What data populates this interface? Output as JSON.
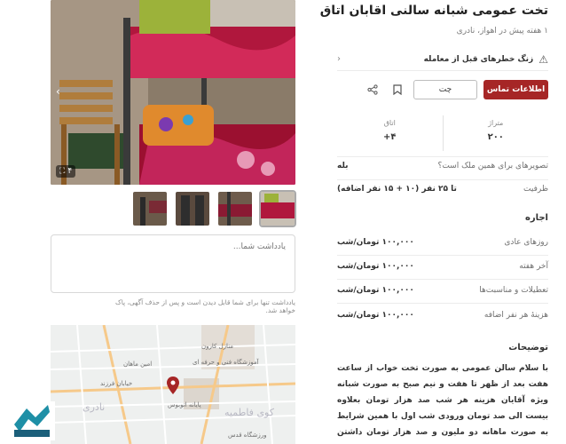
{
  "listing": {
    "title": "تخت عمومی شبانه سالنی اقابان اتاق",
    "subtitle": "۱ هفته پیش در اهواز، نادری",
    "photo_counter": "۴"
  },
  "alert": {
    "text": "زنگ خطرهای قبل از معامله",
    "icon": "warning-icon"
  },
  "actions": {
    "contact": "اطلاعات تماس",
    "chat": "چت"
  },
  "stats": [
    {
      "label": "متراژ",
      "value": "۲۰۰"
    },
    {
      "label": "اتاق",
      "value": "۴+"
    }
  ],
  "details": [
    {
      "label": "تصویرهای برای همین ملک است؟",
      "value": "بله"
    },
    {
      "label": "ظرفیت",
      "value": "تا ۲۵ نفر (۱۰ + ۱۵ نفر اضافه)"
    }
  ],
  "rent": {
    "heading": "اجاره",
    "rows": [
      {
        "label": "روزهای عادی",
        "value": "۱۰۰,۰۰۰ تومان/شب"
      },
      {
        "label": "آخر هفته",
        "value": "۱۰۰,۰۰۰ تومان/شب"
      },
      {
        "label": "تعطیلات و مناسبت‌ها",
        "value": "۱۰۰,۰۰۰ تومان/شب"
      },
      {
        "label": "هزینهٔ هر نفر اضافه",
        "value": "۱۰۰,۰۰۰ تومان/شب"
      }
    ]
  },
  "description": {
    "heading": "توضیحات",
    "text": "با سلام سالن عمومی به صورت تخت خواب از ساعت هفت بعد از ظهر تا هفت و نیم صبح به صورت شبانه ویژه آقایان هزینه هر شب صد هزار تومان بعلاوه بیست الی صد تومان ورودی شب اول با همین شرایط به صورت ماهانه دو ملیون و صد هزار تومان داشتن کارت شناسایی الزامی است از پذیرش افراد معتاد و"
  },
  "note": {
    "placeholder": "یادداشت شما...",
    "help": "یادداشت تنها برای شما قابل دیدن است و پس از حذف آگهی، پاک خواهد شد."
  },
  "map": {
    "labels": [
      "نادری",
      "کوی فاطمیه",
      "منازل کارون",
      "خیابان فرزند",
      "آموزشگاه فنی و حرفه ای",
      "پایانه اتوبوس",
      "امین ماهان",
      "ورزشگاه قدس"
    ]
  },
  "colors": {
    "accent": "#a62626",
    "text": "#2b2b2b",
    "muted": "#8a8a8a"
  }
}
